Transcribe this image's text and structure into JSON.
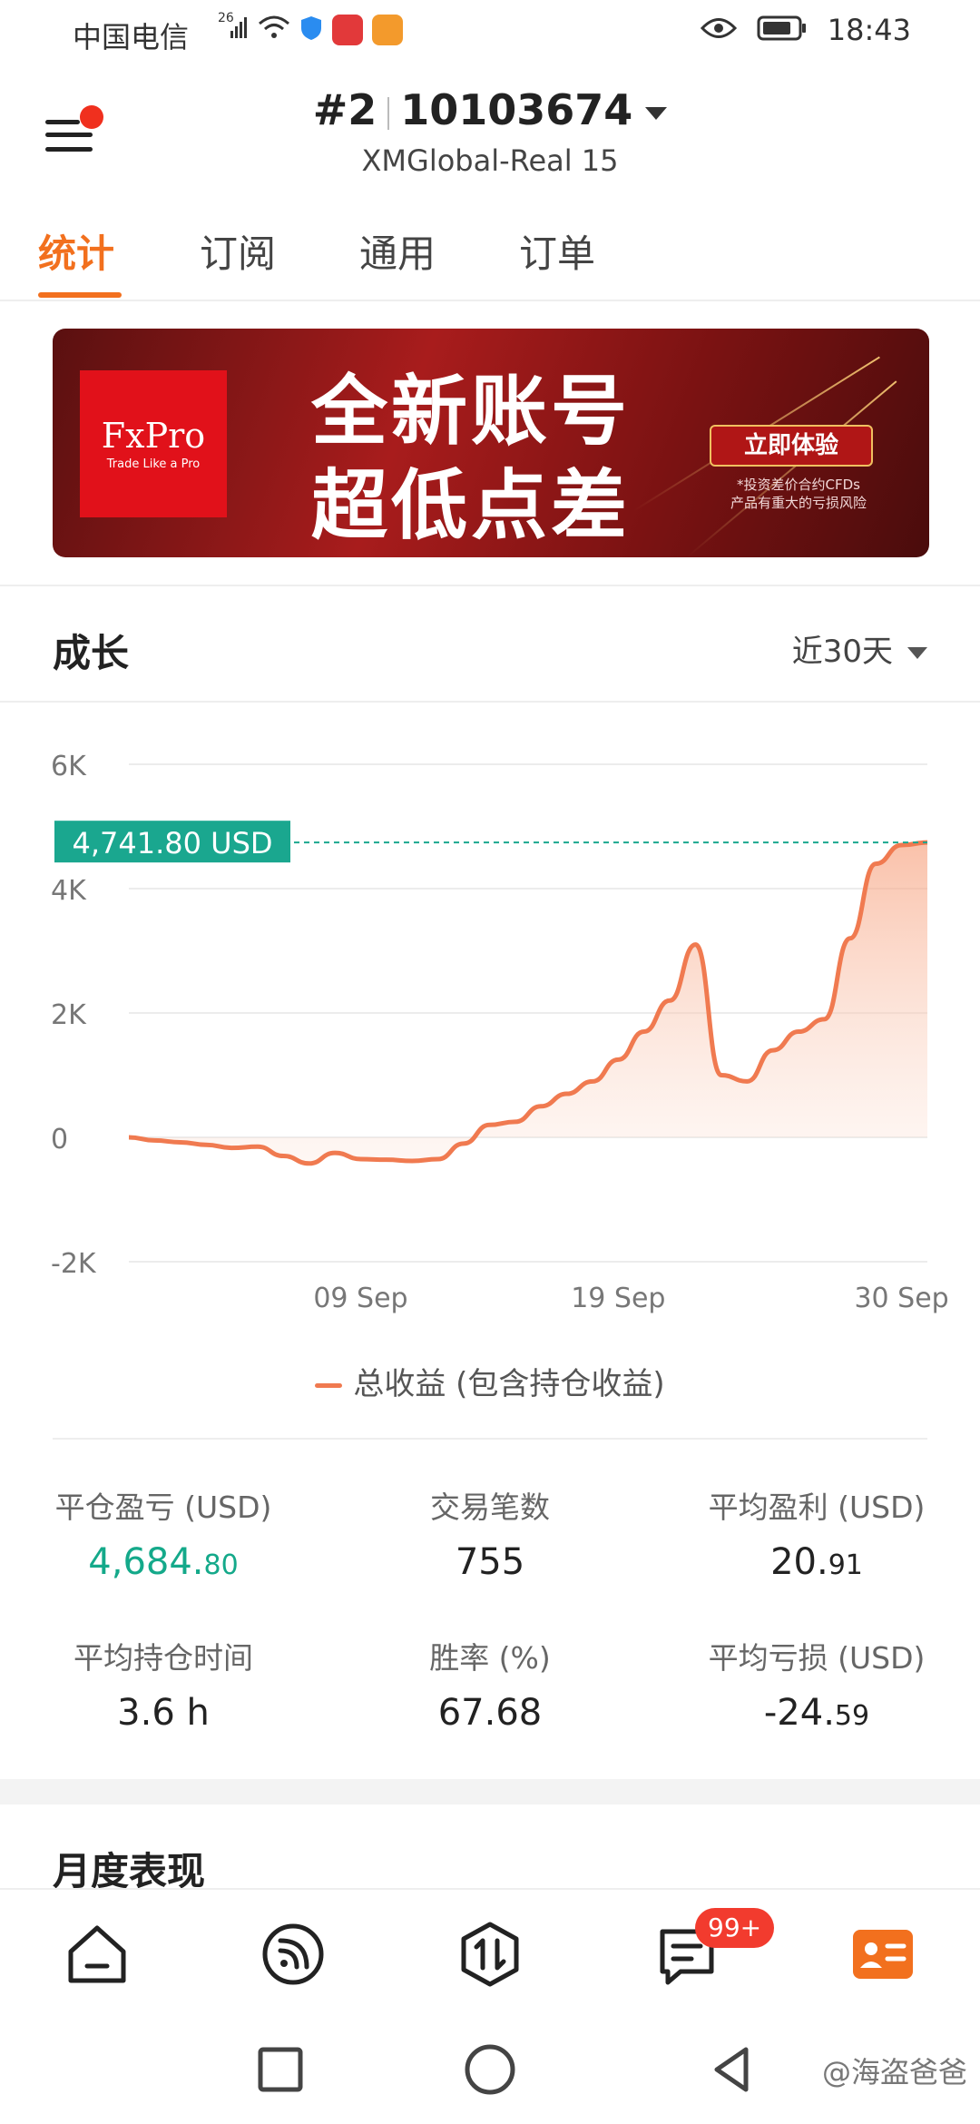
{
  "status_bar": {
    "carrier": "中国电信",
    "signal_label": "26",
    "time": "18:43"
  },
  "header": {
    "account_rank": "#2",
    "account_number": "10103674",
    "server": "XMGlobal-Real 15"
  },
  "tabs": [
    {
      "label": "统计",
      "active": true
    },
    {
      "label": "订阅",
      "active": false
    },
    {
      "label": "通用",
      "active": false
    },
    {
      "label": "订单",
      "active": false
    }
  ],
  "banner": {
    "brand": "FxPro",
    "tagline": "Trade Like a Pro",
    "headline_1": "全新账号",
    "headline_2": "超低点差",
    "cta": "立即体验",
    "note_1": "*投资差价合约CFDs",
    "note_2": "产品有重大的亏损风险"
  },
  "growth": {
    "title": "成长",
    "range": "近30天",
    "current_label": "4,741.80 USD"
  },
  "chart_data": {
    "type": "area",
    "y_ticks": [
      "6K",
      "4K",
      "2K",
      "0",
      "-2K"
    ],
    "ylim": [
      -2000,
      6000
    ],
    "x_ticks": [
      "09 Sep",
      "19 Sep",
      "30 Sep"
    ],
    "series": [
      {
        "name": "总收益 (包含持仓收益)",
        "color": "#f07a50",
        "x": [
          0,
          1,
          2,
          3,
          4,
          5,
          6,
          7,
          8,
          9,
          10,
          11,
          12,
          13,
          14,
          15,
          16,
          17,
          18,
          19,
          20,
          21,
          22,
          23,
          24,
          25,
          26,
          27,
          28,
          29,
          30,
          31
        ],
        "values": [
          0,
          -50,
          -80,
          -120,
          -170,
          -150,
          -300,
          -420,
          -250,
          -350,
          -360,
          -380,
          -350,
          -100,
          200,
          250,
          500,
          700,
          900,
          1250,
          1700,
          2200,
          3100,
          1000,
          900,
          1400,
          1700,
          1900,
          3200,
          4400,
          4700,
          4741.8
        ]
      }
    ],
    "last_value_label": "4,741.80 USD"
  },
  "legend_label": "总收益 (包含持仓收益)",
  "stats": [
    {
      "label": "平仓盈亏 (USD)",
      "value_main": "4,684.",
      "value_dec": "80",
      "green": true
    },
    {
      "label": "交易笔数",
      "value_main": "755",
      "value_dec": "",
      "green": false
    },
    {
      "label": "平均盈利 (USD)",
      "value_main": "20.",
      "value_dec": "91",
      "green": false
    },
    {
      "label": "平均持仓时间",
      "value_main": "3.6 h",
      "value_dec": "",
      "green": false
    },
    {
      "label": "胜率 (%)",
      "value_main": "67.68",
      "value_dec": "",
      "green": false
    },
    {
      "label": "平均亏损 (USD)",
      "value_main": "-24.",
      "value_dec": "59",
      "green": false
    }
  ],
  "monthly_title": "月度表现",
  "bottom_nav": {
    "items": [
      "home-icon",
      "feed-icon",
      "trade-icon",
      "messages-icon",
      "profile-icon"
    ],
    "badge": "99+"
  },
  "watermark": "@海盗爸爸",
  "colors": {
    "accent": "#f2701e",
    "green": "#14a98a",
    "line": "#f07a50",
    "dashed": "#1aa78f"
  }
}
